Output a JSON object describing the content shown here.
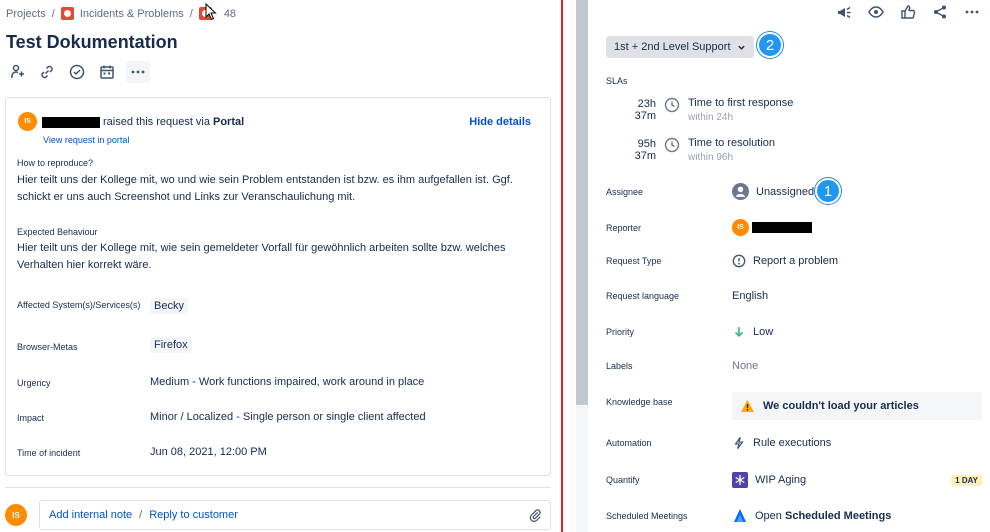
{
  "breadcrumb": {
    "projects": "Projects",
    "separator": "/",
    "queue": "Incidents & Problems",
    "issue_suffix": "48"
  },
  "issue": {
    "title": "Test Dokumentation"
  },
  "toolbar": {
    "icons": [
      "assign-icon",
      "link-icon",
      "check-circle-icon",
      "calendar-icon",
      "more-icon"
    ]
  },
  "request": {
    "avatar_initials": "IS",
    "raised_text": "raised this request via",
    "channel": "Portal",
    "view_portal": "View request in portal",
    "hide_details": "Hide details",
    "how_to_reproduce_label": "How to reproduce?",
    "how_to_reproduce_text": "Hier teilt uns der Kollege mit, wo und wie sein Problem entstanden ist bzw. es ihm aufgefallen ist. Ggf. schickt er uns auch Screenshot und Links zur Veranschaulichung mit.",
    "expected_label": "Expected Behaviour",
    "expected_text": "Hier teilt uns der Kollege mit, wie sein gemeldeter Vorfall für gewöhnlich arbeiten sollte bzw. welches Verhalten hier korrekt wäre.",
    "fields": [
      {
        "label": "Affected System(s)/Services(s)",
        "value": "Becky",
        "tag": true
      },
      {
        "label": "Browser-Metas",
        "value": "Firefox",
        "tag": true
      },
      {
        "label": "Urgency",
        "value": "Medium - Work functions impaired, work around in place",
        "tag": false
      },
      {
        "label": "Impact",
        "value": "Minor / Localized - Single person or single client affected",
        "tag": false
      },
      {
        "label": "Time of incident",
        "value": "Jun 08, 2021, 12:00 PM",
        "tag": false
      }
    ]
  },
  "comment": {
    "avatar_initials": "IS",
    "add_note": "Add internal note",
    "separator": "/",
    "reply": "Reply to customer"
  },
  "sidebar": {
    "status": "1st + 2nd Level Support",
    "badge_status": "2",
    "badge_assignee": "1",
    "slas_label": "SLAs",
    "slas": [
      {
        "time": "23h 37m",
        "desc": "Time to first response",
        "sub": "within 24h"
      },
      {
        "time": "95h 37m",
        "desc": "Time to resolution",
        "sub": "within 96h"
      }
    ],
    "assignee_label": "Assignee",
    "assignee_value": "Unassigned",
    "reporter_label": "Reporter",
    "reporter_initials": "IS",
    "request_type_label": "Request Type",
    "request_type_value": "Report a problem",
    "language_label": "Request language",
    "language_value": "English",
    "priority_label": "Priority",
    "priority_value": "Low",
    "labels_label": "Labels",
    "labels_value": "None",
    "kb_label": "Knowledge base",
    "kb_value": "We couldn't load your articles",
    "automation_label": "Automation",
    "automation_value": "Rule executions",
    "quantify_label": "Quantify",
    "quantify_value": "WIP Aging",
    "quantify_badge": "1 DAY",
    "meetings_label": "Scheduled Meetings",
    "meetings_open": "Open",
    "meetings_value": "Scheduled Meetings"
  },
  "colors": {
    "link": "#0052cc",
    "text": "#172b4d",
    "avatar": "#ff8b00",
    "badge": "#2196f3",
    "divider": "#e3222c"
  }
}
